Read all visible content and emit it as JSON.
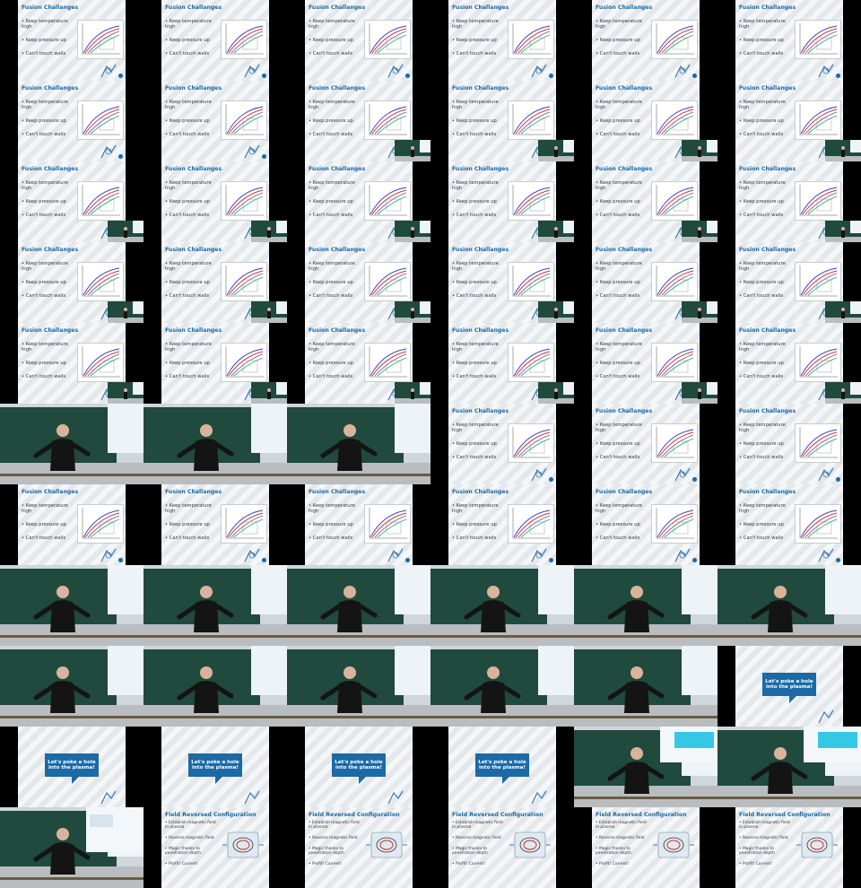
{
  "layout": {
    "columns": 6,
    "rows": 11
  },
  "slide_fusion": {
    "title": "Fusion Challanges",
    "bullets": [
      "Keep temperature high",
      "Keep pressure up",
      "Can't touch walls"
    ]
  },
  "slide_callout": {
    "text": "Let's poke a hole into the plasma!"
  },
  "slide_frc": {
    "title": "Field Reversed Configuration",
    "bullets": [
      "Establish magnetic field in plasma",
      "Reverse magnetic field",
      "Magic thanks to penetration depth",
      "Profit! Current!"
    ]
  },
  "tiles": [
    "fusion",
    "fusion",
    "fusion",
    "fusion",
    "fusion",
    "fusion",
    "fusion",
    "fusion",
    "fusion-pip",
    "fusion-pip",
    "fusion-pip",
    "fusion-pip",
    "fusion-pip",
    "fusion-pip",
    "fusion-pip",
    "fusion-pip",
    "fusion-pip",
    "fusion-pip",
    "fusion-pip",
    "fusion-pip",
    "fusion-pip",
    "fusion-pip",
    "fusion-pip",
    "fusion-pip",
    "fusion-pip",
    "fusion-pip",
    "fusion-pip",
    "fusion-pip",
    "fusion-pip",
    "fusion-pip",
    "cam",
    "cam",
    "cam",
    "fusion",
    "fusion",
    "fusion",
    "fusion",
    "fusion",
    "fusion",
    "fusion",
    "fusion",
    "fusion",
    "cam",
    "cam",
    "cam",
    "cam",
    "cam",
    "cam",
    "cam",
    "cam",
    "cam",
    "cam",
    "cam",
    "callout",
    "callout",
    "callout",
    "callout",
    "callout",
    "cam-callout",
    "cam-callout",
    "cam-frc",
    "frc",
    "frc",
    "frc",
    "frc",
    "frc"
  ],
  "colors": {
    "accent": "#1b6aa5",
    "slide_bg": "#e9ecef",
    "board": "#1f4a3d"
  }
}
